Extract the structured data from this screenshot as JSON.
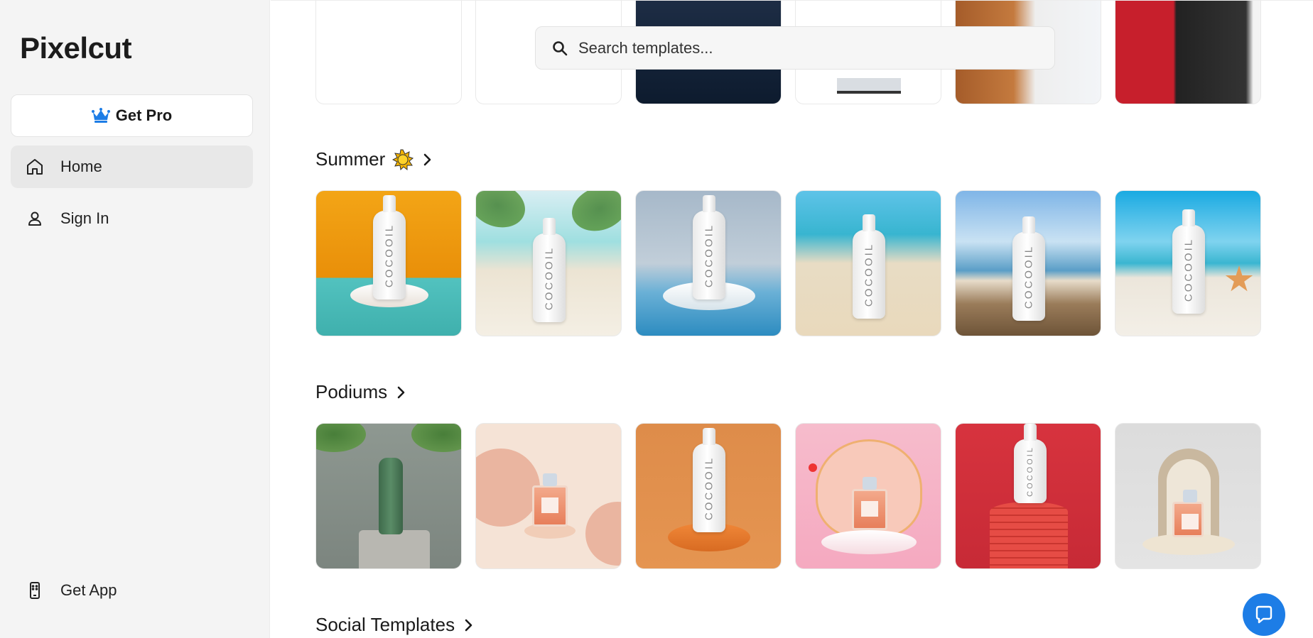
{
  "app": {
    "logo": "Pixelcut"
  },
  "sidebar": {
    "get_pro_label": "Get Pro",
    "items": [
      {
        "label": "Home",
        "icon": "home-icon",
        "active": true
      },
      {
        "label": "Sign In",
        "icon": "user-icon",
        "active": false
      }
    ],
    "get_app_label": "Get App"
  },
  "search": {
    "placeholder": "Search templates..."
  },
  "sections": [
    {
      "title": "Summer",
      "emoji": "sun-emoji",
      "tile_label": "COCOOIL"
    },
    {
      "title": "Podiums",
      "tile_label": "COCOOIL"
    },
    {
      "title": "Social Templates"
    }
  ],
  "colors": {
    "accent": "#1d7de6",
    "sidebar_bg": "#f4f4f4",
    "crown": "#1d7de6"
  }
}
